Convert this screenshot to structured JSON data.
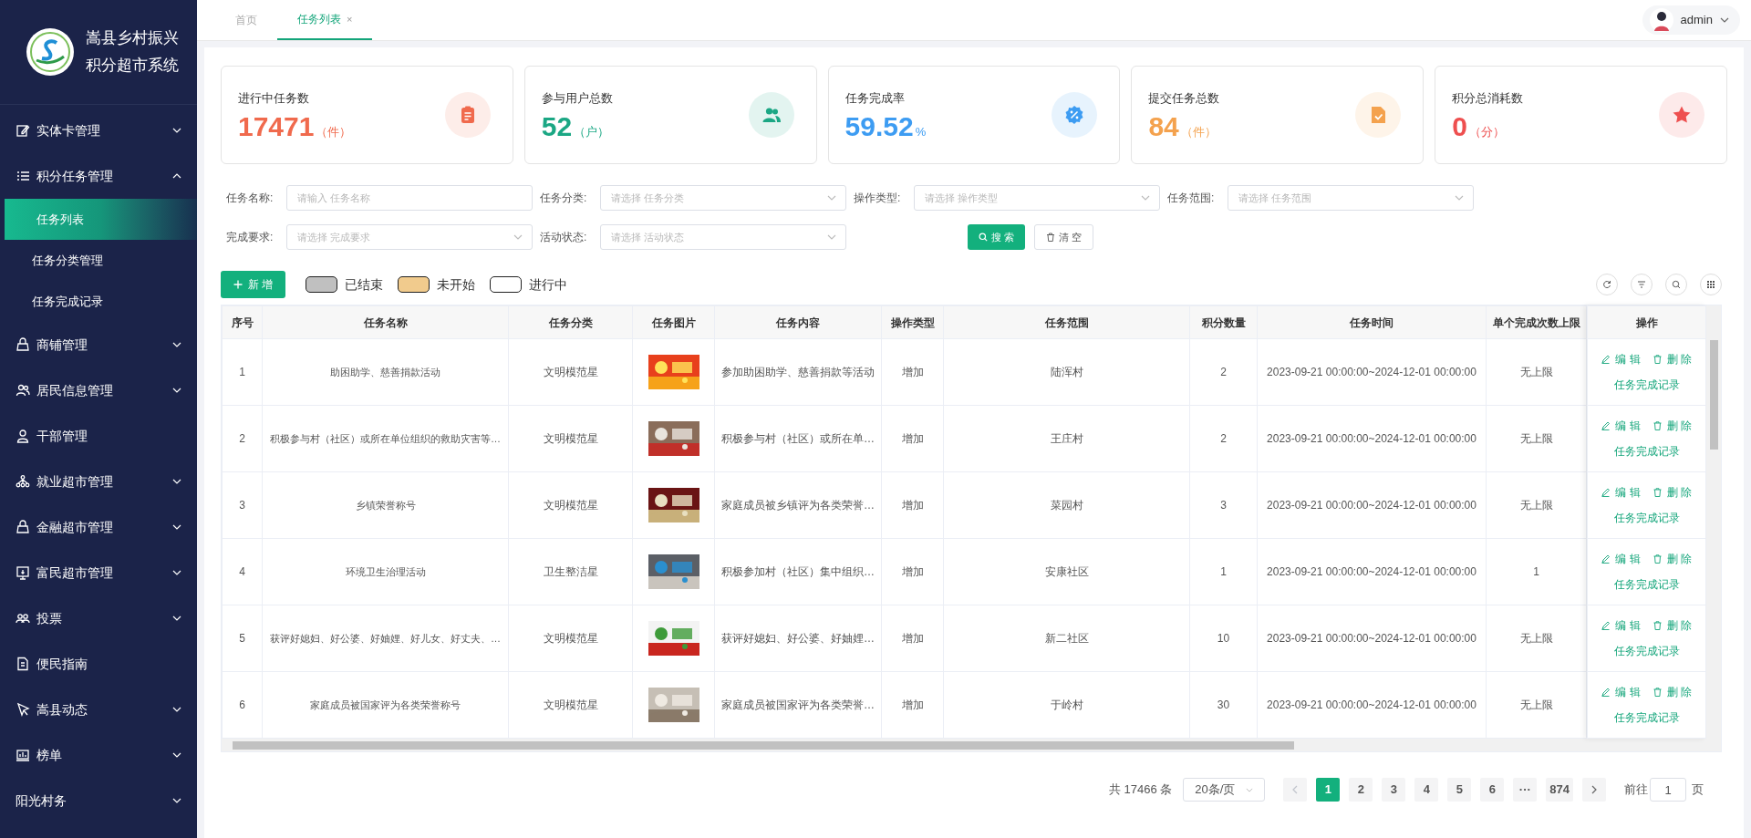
{
  "sidebar": {
    "title_lines": [
      "嵩县乡村振兴",
      "积分超市系统"
    ],
    "items": [
      {
        "label": "实体卡管理",
        "expanded": false
      },
      {
        "label": "积分任务管理",
        "expanded": true,
        "children": [
          {
            "label": "任务列表",
            "selected": true
          },
          {
            "label": "任务分类管理",
            "selected": false
          },
          {
            "label": "任务完成记录",
            "selected": false
          }
        ]
      },
      {
        "label": "商铺管理",
        "expanded": false
      },
      {
        "label": "居民信息管理",
        "expanded": false
      },
      {
        "label": "干部管理"
      },
      {
        "label": "就业超市管理",
        "expanded": false
      },
      {
        "label": "金融超市管理",
        "expanded": false
      },
      {
        "label": "富民超市管理",
        "expanded": false
      },
      {
        "label": "投票",
        "expanded": false
      },
      {
        "label": "便民指南"
      },
      {
        "label": "嵩县动态",
        "expanded": false
      },
      {
        "label": "榜单",
        "expanded": false
      },
      {
        "label": "阳光村务",
        "expanded": false
      }
    ]
  },
  "tabs": [
    {
      "label": "首页",
      "selected": false
    },
    {
      "label": "任务列表",
      "selected": true,
      "close": "×"
    }
  ],
  "user": {
    "name": "admin"
  },
  "stats": [
    {
      "label": "进行中任务数",
      "value": "17471",
      "unit": "（件）",
      "color": "#f06a4d"
    },
    {
      "label": "参与用户总数",
      "value": "52",
      "unit": "（户）",
      "color": "#1ba784"
    },
    {
      "label": "任务完成率",
      "value": "59.52",
      "unit": "%",
      "color": "#3d9cf2"
    },
    {
      "label": "提交任务总数",
      "value": "84",
      "unit": "（件）",
      "color": "#f4a24e"
    },
    {
      "label": "积分总消耗数",
      "value": "0",
      "unit": "（分）",
      "color": "#ee4f4f"
    }
  ],
  "filters": [
    {
      "label": "任务名称:",
      "placeholder": "请输入 任务名称",
      "kind": "input"
    },
    {
      "label": "任务分类:",
      "placeholder": "请选择 任务分类",
      "kind": "select"
    },
    {
      "label": "操作类型:",
      "placeholder": "请选择 操作类型",
      "kind": "select"
    },
    {
      "label": "任务范围:",
      "placeholder": "请选择 任务范围",
      "kind": "select"
    },
    {
      "label": "完成要求:",
      "placeholder": "请选择 完成要求",
      "kind": "select"
    },
    {
      "label": "活动状态:",
      "placeholder": "请选择 活动状态",
      "kind": "select"
    }
  ],
  "search_button": "搜 索",
  "clear_button": "清 空",
  "add_button": "新 增",
  "legend": [
    {
      "label": "已结束",
      "color": "#c0c0c0"
    },
    {
      "label": "未开始",
      "color": "#f1cb8d"
    },
    {
      "label": "进行中",
      "color": "#ffffff"
    }
  ],
  "table": {
    "columns": [
      "序号",
      "任务名称",
      "任务分类",
      "任务图片",
      "任务内容",
      "操作类型",
      "任务范围",
      "积分数量",
      "任务时间",
      "单个完成次数上限",
      "操作"
    ],
    "rows": [
      {
        "cells": [
          "1",
          "助困助学、慈善捐款活动",
          "文明模范星",
          "",
          "参加助困助学、慈善捐款等活动",
          "增加",
          "陆浑村",
          "2",
          "2023-09-21 00:00:00~2024-12-01 00:00:00",
          "无上限"
        ],
        "actions": [
          "编 辑",
          "删 除",
          "任务完成记录"
        ]
      },
      {
        "cells": [
          "2",
          "积极参与村（社区）或所在单位组织的救助灾害等…",
          "文明模范星",
          "",
          "积极参与村（社区）或所在单…",
          "增加",
          "王庄村",
          "2",
          "2023-09-21 00:00:00~2024-12-01 00:00:00",
          "无上限"
        ],
        "actions": [
          "编 辑",
          "删 除",
          "任务完成记录"
        ]
      },
      {
        "cells": [
          "3",
          "乡镇荣誉称号",
          "文明模范星",
          "",
          "家庭成员被乡镇评为各类荣誉…",
          "增加",
          "菜园村",
          "3",
          "2023-09-21 00:00:00~2024-12-01 00:00:00",
          "无上限"
        ],
        "actions": [
          "编 辑",
          "删 除",
          "任务完成记录"
        ]
      },
      {
        "cells": [
          "4",
          "环境卫生治理活动",
          "卫生整洁星",
          "",
          "积极参加村（社区）集中组织…",
          "增加",
          "安康社区",
          "1",
          "2023-09-21 00:00:00~2024-12-01 00:00:00",
          "1"
        ],
        "actions": [
          "编 辑",
          "删 除",
          "任务完成记录"
        ]
      },
      {
        "cells": [
          "5",
          "获评好媳妇、好公婆、好妯娌、好儿女、好丈夫、…",
          "文明模范星",
          "",
          "获评好媳妇、好公婆、好妯娌…",
          "增加",
          "新二社区",
          "10",
          "2023-09-21 00:00:00~2024-12-01 00:00:00",
          "无上限"
        ],
        "actions": [
          "编 辑",
          "删 除",
          "任务完成记录"
        ]
      },
      {
        "cells": [
          "6",
          "家庭成员被国家评为各类荣誉称号",
          "文明模范星",
          "",
          "家庭成员被国家评为各类荣誉…",
          "增加",
          "于岭村",
          "30",
          "2023-09-21 00:00:00~2024-12-01 00:00:00",
          "无上限"
        ],
        "actions": [
          "编 辑",
          "删 除",
          "任务完成记录"
        ]
      }
    ]
  },
  "pagination": {
    "total": "共 17466 条",
    "page_size": "20条/页",
    "pages": [
      {
        "label": "1",
        "selected": true
      },
      {
        "label": "2",
        "selected": false
      },
      {
        "label": "3",
        "selected": false
      },
      {
        "label": "4",
        "selected": false
      },
      {
        "label": "5",
        "selected": false
      },
      {
        "label": "6",
        "selected": false
      },
      {
        "label": "···",
        "selected": false
      },
      {
        "label": "874",
        "selected": false
      }
    ],
    "goto_label": "前往",
    "goto_value": "1",
    "goto_suffix": "页"
  }
}
